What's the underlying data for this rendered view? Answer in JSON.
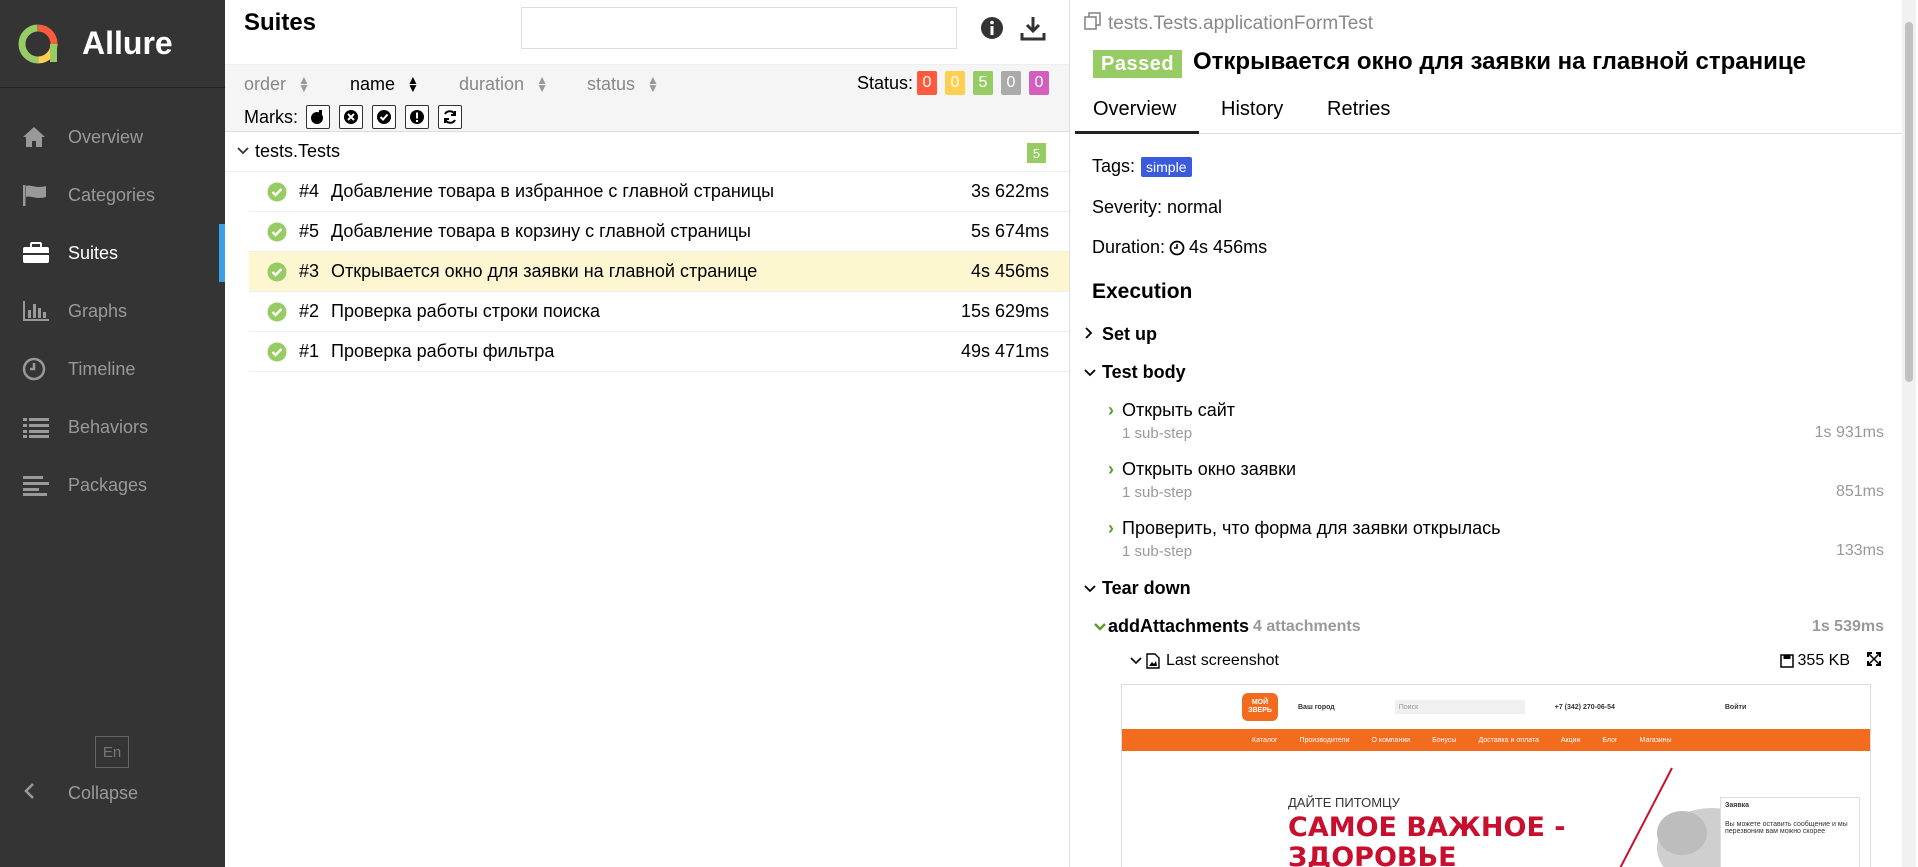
{
  "brand": {
    "title": "Allure"
  },
  "sidebar": {
    "items": [
      {
        "label": "Overview",
        "icon": "home-icon"
      },
      {
        "label": "Categories",
        "icon": "flag-icon"
      },
      {
        "label": "Suites",
        "icon": "briefcase-icon",
        "active": true
      },
      {
        "label": "Graphs",
        "icon": "bar-chart-icon"
      },
      {
        "label": "Timeline",
        "icon": "clock-icon"
      },
      {
        "label": "Behaviors",
        "icon": "list-icon"
      },
      {
        "label": "Packages",
        "icon": "align-left-icon"
      }
    ],
    "language": "En",
    "collapse_label": "Collapse"
  },
  "suites": {
    "title": "Suites",
    "search": {
      "value": "",
      "placeholder": ""
    },
    "sort": {
      "order": "order",
      "name": "name",
      "duration": "duration",
      "status": "status"
    },
    "status_label": "Status:",
    "status_counts": [
      {
        "value": "0",
        "color": "#fd5a3e"
      },
      {
        "value": "0",
        "color": "#ffd050"
      },
      {
        "value": "5",
        "color": "#97cc64"
      },
      {
        "value": "0",
        "color": "#aaaaaa"
      },
      {
        "value": "0",
        "color": "#d35ebe"
      }
    ],
    "marks_label": "Marks:",
    "group": {
      "name": "tests.Tests",
      "count": "5"
    },
    "rows": [
      {
        "num": "#4",
        "name": "Добавление товара в избранное с главной страницы",
        "duration": "3s 622ms"
      },
      {
        "num": "#5",
        "name": "Добавление товара в корзину с главной страницы",
        "duration": "5s 674ms"
      },
      {
        "num": "#3",
        "name": "Открывается окно для заявки на главной странице",
        "duration": "4s 456ms"
      },
      {
        "num": "#2",
        "name": "Проверка работы строки поиска",
        "duration": "15s 629ms"
      },
      {
        "num": "#1",
        "name": "Проверка работы фильтра",
        "duration": "49s 471ms"
      }
    ]
  },
  "detail": {
    "path": "tests.Tests.applicationFormTest",
    "status": "Passed",
    "title": "Открывается окно для заявки на главной странице",
    "tabs": [
      "Overview",
      "History",
      "Retries"
    ],
    "tags_label": "Tags:",
    "tag": "simple",
    "severity": "Severity: normal",
    "duration_label": "Duration:",
    "duration": "4s 456ms",
    "execution": "Execution",
    "setup": "Set up",
    "test_body": "Test body",
    "steps": [
      {
        "name": "Открыть сайт",
        "sub": "1 sub-step",
        "duration": "1s 931ms"
      },
      {
        "name": "Открыть окно заявки",
        "sub": "1 sub-step",
        "duration": "851ms"
      },
      {
        "name": "Проверить, что форма для заявки открылась",
        "sub": "1 sub-step",
        "duration": "133ms"
      }
    ],
    "teardown": "Tear down",
    "attachments": {
      "name": "addAttachments",
      "count": "4 attachments",
      "duration": "1s 539ms"
    },
    "screenshot": {
      "name": "Last screenshot",
      "size": "355 KB"
    },
    "site": {
      "logo": "МОЙ ЗВЕРЬ",
      "city": "Ваш город",
      "search_placeholder": "Поиск",
      "phone": "+7 (342) 270-06-54",
      "login": "Войти",
      "nav": [
        "Каталог",
        "Производители",
        "О компании",
        "Бонусы",
        "Доставка и оплата",
        "Акции",
        "Блог",
        "Магазины"
      ],
      "hero_small": "ДАЙТЕ ПИТОМЦУ",
      "hero_big_1": "САМОЕ ВАЖНОЕ -",
      "hero_big_2": "ЗДОРОВЬЕ",
      "popup_title": "Заявка",
      "popup_text": "Вы можете оставить сообщение и мы перезвоним вам можно скорее"
    }
  }
}
